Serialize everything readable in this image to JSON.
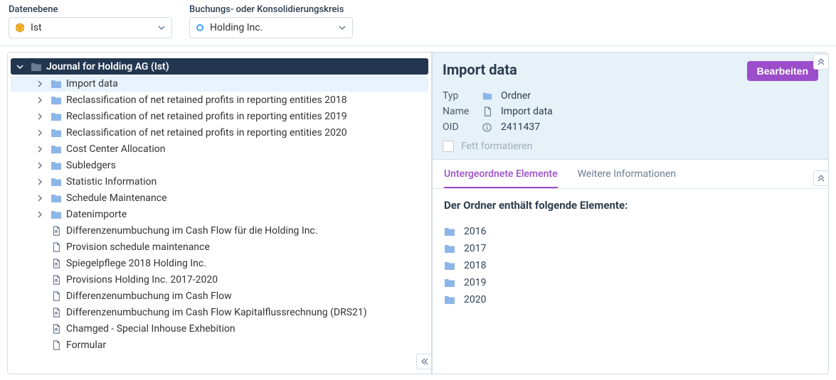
{
  "topbar": {
    "field1_label": "Datenebene",
    "field1_value": "Ist",
    "field2_label": "Buchungs- oder Konsolidierungskreis",
    "field2_value": "Holding Inc."
  },
  "tree": {
    "root_label": "Journal for Holding AG (Ist)",
    "items": [
      {
        "label": "Import data",
        "type": "folder",
        "expandable": true,
        "selected": true
      },
      {
        "label": "Reclassification of net retained profits in reporting entities 2018",
        "type": "folder",
        "expandable": true
      },
      {
        "label": "Reclassification of net retained profits in reporting entities 2019",
        "type": "folder",
        "expandable": true
      },
      {
        "label": "Reclassification of net retained profits in reporting entities 2020",
        "type": "folder",
        "expandable": true
      },
      {
        "label": "Cost Center Allocation",
        "type": "folder",
        "expandable": true
      },
      {
        "label": "Subledgers",
        "type": "folder",
        "expandable": true
      },
      {
        "label": "Statistic Information",
        "type": "folder",
        "expandable": true
      },
      {
        "label": "Schedule Maintenance",
        "type": "folder",
        "expandable": true
      },
      {
        "label": "Datenimporte",
        "type": "folder",
        "expandable": true
      },
      {
        "label": "Differenzenumbuchung im Cash Flow für die Holding Inc.",
        "type": "doc",
        "expandable": false
      },
      {
        "label": "Provision schedule maintenance",
        "type": "doc",
        "expandable": false
      },
      {
        "label": "Spiegelpflege 2018 Holding Inc.",
        "type": "doc",
        "expandable": false
      },
      {
        "label": "Provisions Holding Inc. 2017-2020",
        "type": "doc",
        "expandable": false
      },
      {
        "label": "Differenzenumbuchung im Cash Flow",
        "type": "doc",
        "expandable": false
      },
      {
        "label": "Differenzenumbuchung im Cash Flow Kapitalflussrechnung (DRS21)",
        "type": "doc",
        "expandable": false
      },
      {
        "label": "Chamged - Special Inhouse Exhebition",
        "type": "doc",
        "expandable": false
      },
      {
        "label": "Formular",
        "type": "doc",
        "expandable": false
      }
    ]
  },
  "details": {
    "title": "Import data",
    "edit_button": "Bearbeiten",
    "type_label": "Typ",
    "type_value": "Ordner",
    "name_label": "Name",
    "name_value": "Import data",
    "oid_label": "OID",
    "oid_value": "2411437",
    "bold_label": "Fett formatieren",
    "tabs": {
      "t1": "Untergeordnete Elemente",
      "t2": "Weitere Informationen"
    },
    "body_heading": "Der Ordner enthält folgende Elemente:",
    "subitems": [
      {
        "label": "2016"
      },
      {
        "label": "2017"
      },
      {
        "label": "2018"
      },
      {
        "label": "2019"
      },
      {
        "label": "2020"
      }
    ]
  }
}
